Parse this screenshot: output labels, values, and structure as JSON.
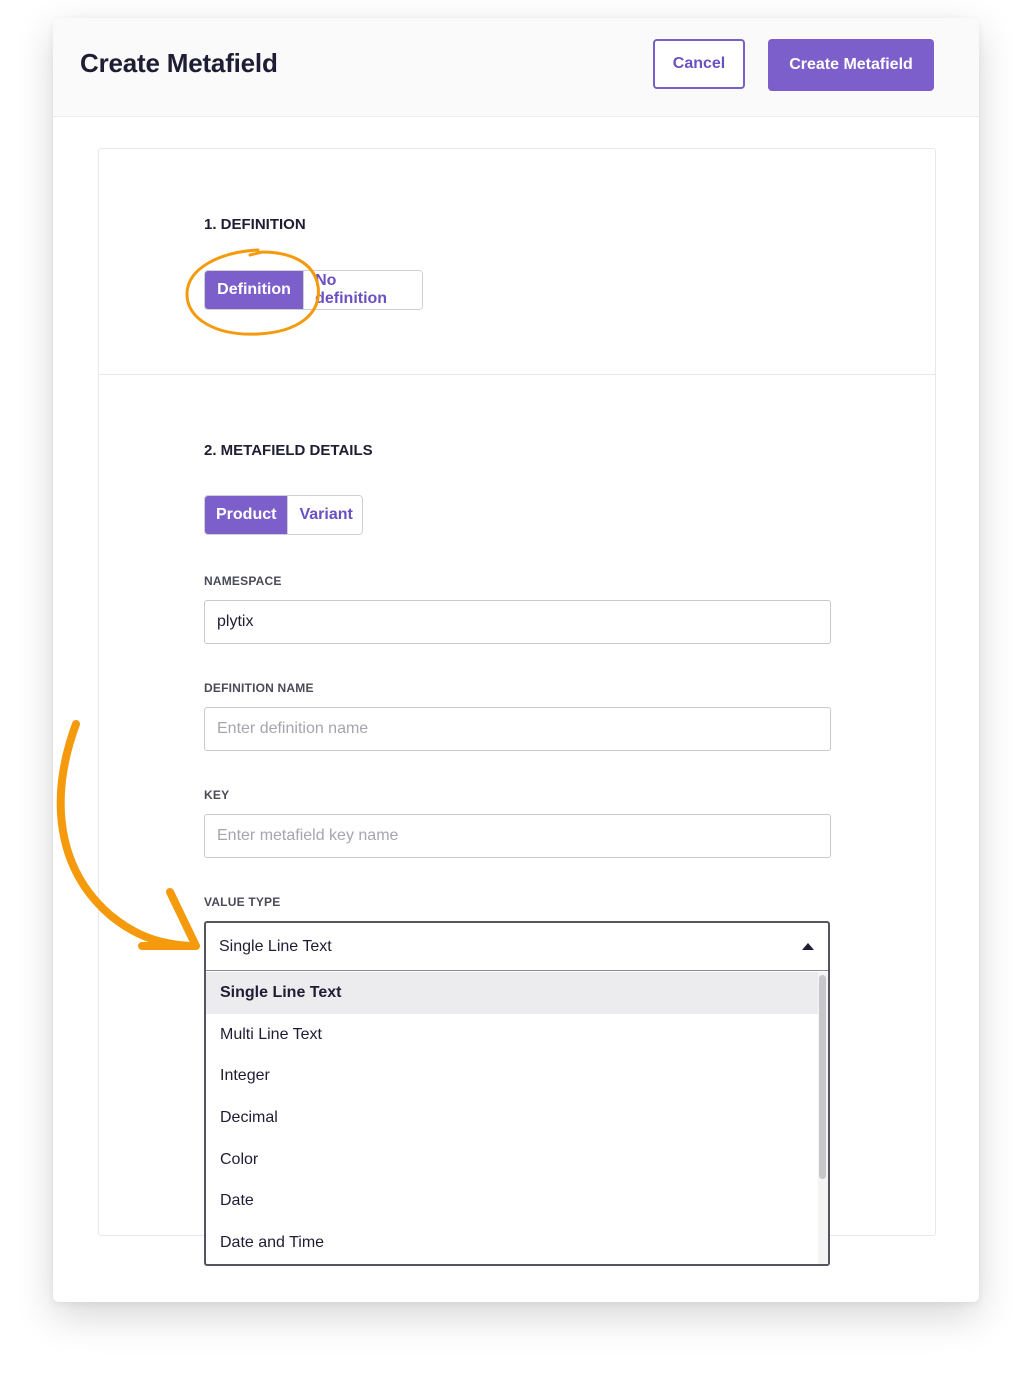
{
  "header": {
    "title": "Create Metafield",
    "cancel_label": "Cancel",
    "create_label": "Create Metafield"
  },
  "definition_section": {
    "heading": "1. DEFINITION",
    "options": [
      {
        "label": "Definition",
        "active": true
      },
      {
        "label": "No definition",
        "active": false
      }
    ]
  },
  "details_section": {
    "heading": "2. METAFIELD DETAILS",
    "scope_options": [
      {
        "label": "Product",
        "active": true
      },
      {
        "label": "Variant",
        "active": false
      }
    ],
    "namespace": {
      "label": "NAMESPACE",
      "value": "plytix"
    },
    "definition_name": {
      "label": "DEFINITION NAME",
      "value": "",
      "placeholder": "Enter definition name"
    },
    "key": {
      "label": "KEY",
      "value": "",
      "placeholder": "Enter metafield key name"
    },
    "value_type": {
      "label": "VALUE TYPE",
      "selected": "Single Line Text",
      "options": [
        "Single Line Text",
        "Multi Line Text",
        "Integer",
        "Decimal",
        "Color",
        "Date",
        "Date and Time"
      ]
    }
  },
  "colors": {
    "accent": "#7d5fcb",
    "annotation": "#f59a0c"
  }
}
